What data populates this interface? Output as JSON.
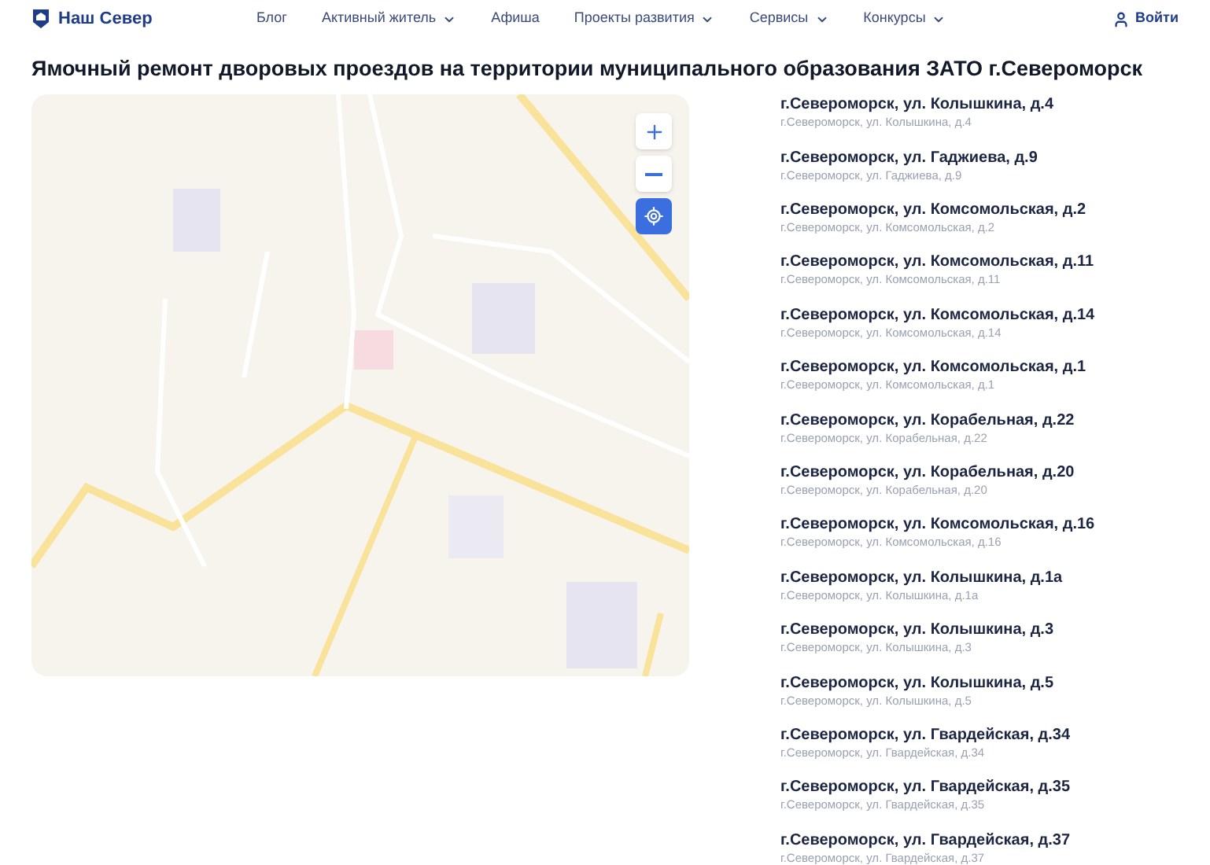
{
  "header": {
    "logo": "Наш Север",
    "nav": [
      {
        "label": "Блог",
        "dropdown": false
      },
      {
        "label": "Активный житель",
        "dropdown": true
      },
      {
        "label": "Афиша",
        "dropdown": false
      },
      {
        "label": "Проекты развития",
        "dropdown": true
      },
      {
        "label": "Сервисы",
        "dropdown": true
      },
      {
        "label": "Конкурсы",
        "dropdown": true
      }
    ],
    "login": "Войти"
  },
  "title": "Ямочный ремонт дворовых проездов на территории муниципального образования ЗАТО г.Североморск",
  "addresses": [
    {
      "title": "г.Североморск, ул. Колышкина, д.4",
      "subtitle": "г.Североморск, ул. Колышкина, д.4"
    },
    {
      "title": "г.Североморск, ул. Гаджиева, д.9",
      "subtitle": "г.Североморск, ул. Гаджиева, д.9"
    },
    {
      "title": "г.Североморск, ул. Комсомольская, д.2",
      "subtitle": "г.Североморск, ул. Комсомольская, д.2"
    },
    {
      "title": "г.Североморск, ул. Комсомольская, д.11",
      "subtitle": "г.Североморск, ул. Комсомольская, д.11"
    },
    {
      "title": "г.Североморск, ул. Комсомольская, д.14",
      "subtitle": "г.Североморск, ул. Комсомольская, д.14"
    },
    {
      "title": "г.Североморск, ул. Комсомольская, д.1",
      "subtitle": "г.Североморск, ул. Комсомольская, д.1"
    },
    {
      "title": "г.Североморск, ул. Корабельная, д.22",
      "subtitle": "г.Североморск, ул. Корабельная, д.22"
    },
    {
      "title": "г.Североморск, ул. Корабельная, д.20",
      "subtitle": "г.Североморск, ул. Корабельная, д.20"
    },
    {
      "title": "г.Североморск, ул. Комсомольская, д.16",
      "subtitle": "г.Североморск, ул. Комсомольская, д.16"
    },
    {
      "title": "г.Североморск, ул. Колышкина, д.1а",
      "subtitle": "г.Североморск, ул. Колышкина, д.1а"
    },
    {
      "title": "г.Североморск, ул. Колышкина, д.3",
      "subtitle": "г.Североморск, ул. Колышкина, д.3"
    },
    {
      "title": "г.Североморск, ул. Колышкина, д.5",
      "subtitle": "г.Североморск, ул. Колышкина, д.5"
    },
    {
      "title": "г.Североморск, ул. Гвардейская, д.34",
      "subtitle": "г.Североморск, ул. Гвардейская, д.34"
    },
    {
      "title": "г.Североморск, ул. Гвардейская, д.35",
      "subtitle": "г.Североморск, ул. Гвардейская, д.35"
    },
    {
      "title": "г.Североморск, ул. Гвардейская, д.37",
      "subtitle": "г.Североморск, ул. Гвардейская, д.37"
    }
  ]
}
